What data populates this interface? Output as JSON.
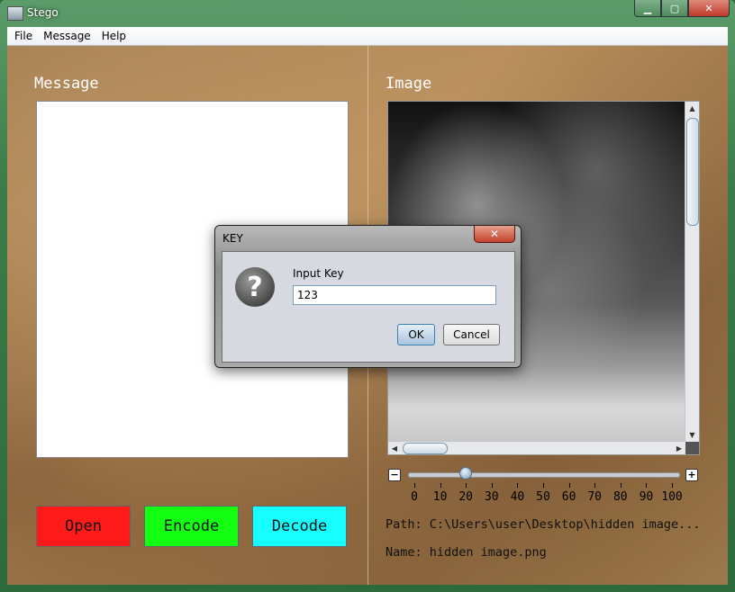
{
  "window": {
    "title": "Stego",
    "icon": "picture-icon",
    "controls": [
      "minimize-icon",
      "maximize-icon",
      "close-icon"
    ]
  },
  "menu": [
    {
      "label": "File"
    },
    {
      "label": "Message"
    },
    {
      "label": "Help"
    }
  ],
  "message_panel": {
    "label": "Message",
    "text": ""
  },
  "buttons": {
    "open": {
      "label": "Open",
      "color": "#ff1a1a"
    },
    "encode": {
      "label": "Encode",
      "color": "#12ff12"
    },
    "decode": {
      "label": "Decode",
      "color": "#16ffff"
    }
  },
  "image_panel": {
    "label": "Image",
    "zoom": {
      "min": 0,
      "max": 100,
      "value": 20,
      "ticks": [
        "0",
        "10",
        "20",
        "30",
        "40",
        "50",
        "60",
        "70",
        "80",
        "90",
        "100"
      ],
      "minus": "−",
      "plus": "+"
    },
    "path_text": "Path: C:\\Users\\user\\Desktop\\hidden image...",
    "name_text": "Name: hidden image.png"
  },
  "dialog": {
    "title": "KEY",
    "icon": "question-icon",
    "prompt": "Input Key",
    "input_value": "123",
    "ok_label": "OK",
    "cancel_label": "Cancel",
    "close": "✕"
  }
}
